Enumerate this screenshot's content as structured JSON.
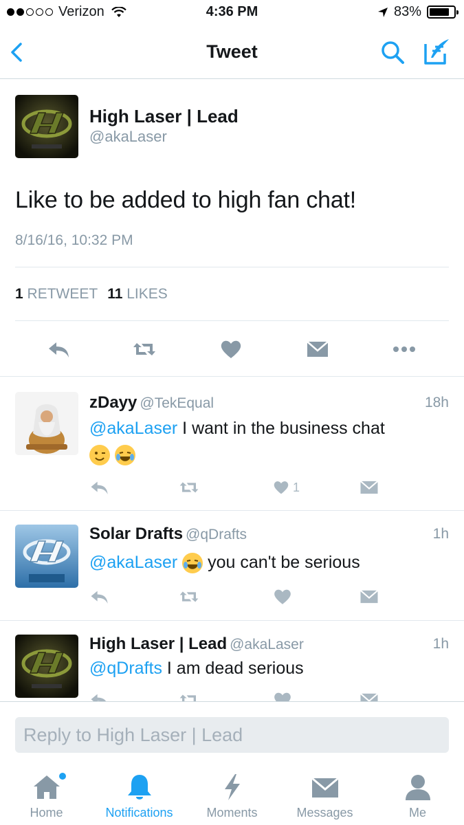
{
  "status_bar": {
    "carrier": "Verizon",
    "time": "4:36 PM",
    "battery": "83%",
    "battery_level": 0.83
  },
  "nav": {
    "title": "Tweet"
  },
  "main_tweet": {
    "name": "High Laser | Lead",
    "handle": "@akaLaser",
    "text": "Like to be added to high fan chat!",
    "timestamp": "8/16/16, 10:32 PM",
    "retweets_count": "1",
    "retweets_label": "RETWEET",
    "likes_count": "11",
    "likes_label": "LIKES"
  },
  "replies": [
    {
      "name": "zDayy",
      "handle": "@TekEqual",
      "time": "18h",
      "mention": "@akaLaser",
      "text": " I want in the business chat",
      "emojis": [
        "wink-emoji",
        "tears-of-joy-emoji"
      ],
      "like_count": "1"
    },
    {
      "name": "Solar Drafts",
      "handle": "@qDrafts",
      "time": "1h",
      "mention": "@akaLaser",
      "text": " you can't be serious",
      "emojis": [
        "tears-of-joy-emoji"
      ],
      "like_count": ""
    },
    {
      "name": "High Laser | Lead",
      "handle": "@akaLaser",
      "time": "1h",
      "mention": "@qDrafts",
      "text": " I am dead serious",
      "emojis": [],
      "like_count": ""
    }
  ],
  "reply_box": {
    "placeholder": "Reply to High Laser | Lead"
  },
  "tabs": [
    {
      "label": "Home",
      "icon": "home-icon"
    },
    {
      "label": "Notifications",
      "icon": "bell-icon"
    },
    {
      "label": "Moments",
      "icon": "lightning-icon"
    },
    {
      "label": "Messages",
      "icon": "envelope-icon"
    },
    {
      "label": "Me",
      "icon": "person-icon"
    }
  ],
  "colors": {
    "accent": "#1da1f2",
    "muted": "#8899a6",
    "icon_gray": "#aab8c2"
  }
}
